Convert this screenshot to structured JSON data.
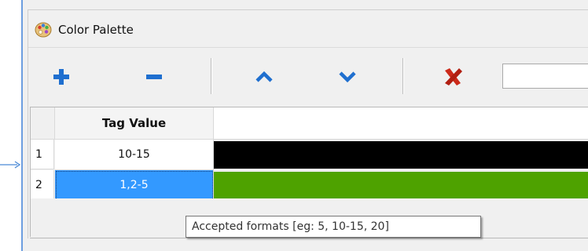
{
  "window": {
    "title": "Color Palette"
  },
  "toolbar": {
    "add_icon": "plus-icon",
    "remove_icon": "minus-icon",
    "move_up_icon": "chevron-up-icon",
    "move_down_icon": "chevron-down-icon",
    "delete_icon": "red-x-icon",
    "input_value": ""
  },
  "grid": {
    "column_header": "Tag Value",
    "rows": [
      {
        "index": "1",
        "value": "10-15",
        "color": "#000000"
      },
      {
        "index": "2",
        "value": "1,2-5",
        "color": "#4ea200"
      }
    ],
    "selected_row": 1
  },
  "tooltip": {
    "text": "Accepted formats [eg: 5, 10-15, 20]"
  },
  "colors": {
    "accent_blue": "#1f6fcf",
    "selection": "#3399ff",
    "delete_red": "#cc2a1a"
  }
}
